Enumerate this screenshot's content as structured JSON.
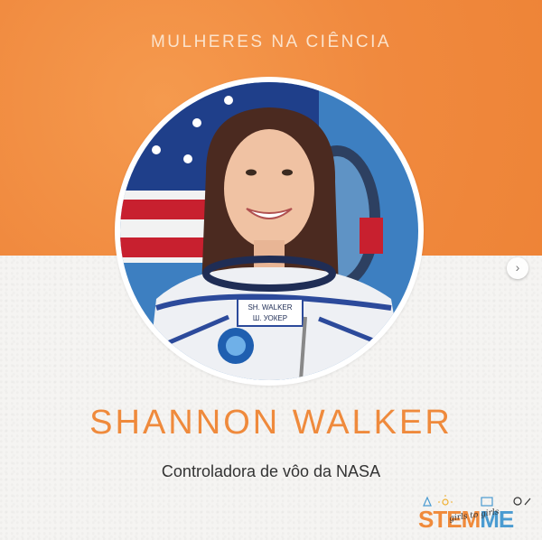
{
  "post": {
    "heading": "MULHERES NA CIÊNCIA",
    "name": "SHANNON WALKER",
    "subtitle": "Controladora de vôo da NASA",
    "photo_subject": "astronaut-portrait",
    "name_patch_line1": "SH. WALKER",
    "name_patch_line2": "Ш. УОКЕР"
  },
  "carousel": {
    "next_icon": "chevron-right-icon"
  },
  "logo": {
    "part1": "STEM",
    "part2": "ME",
    "tagline": "girls to girls"
  },
  "colors": {
    "orange": "#ef8a3c",
    "heading": "#fbe3cc",
    "text": "#333333",
    "logo_blue": "#4a9bd1"
  }
}
